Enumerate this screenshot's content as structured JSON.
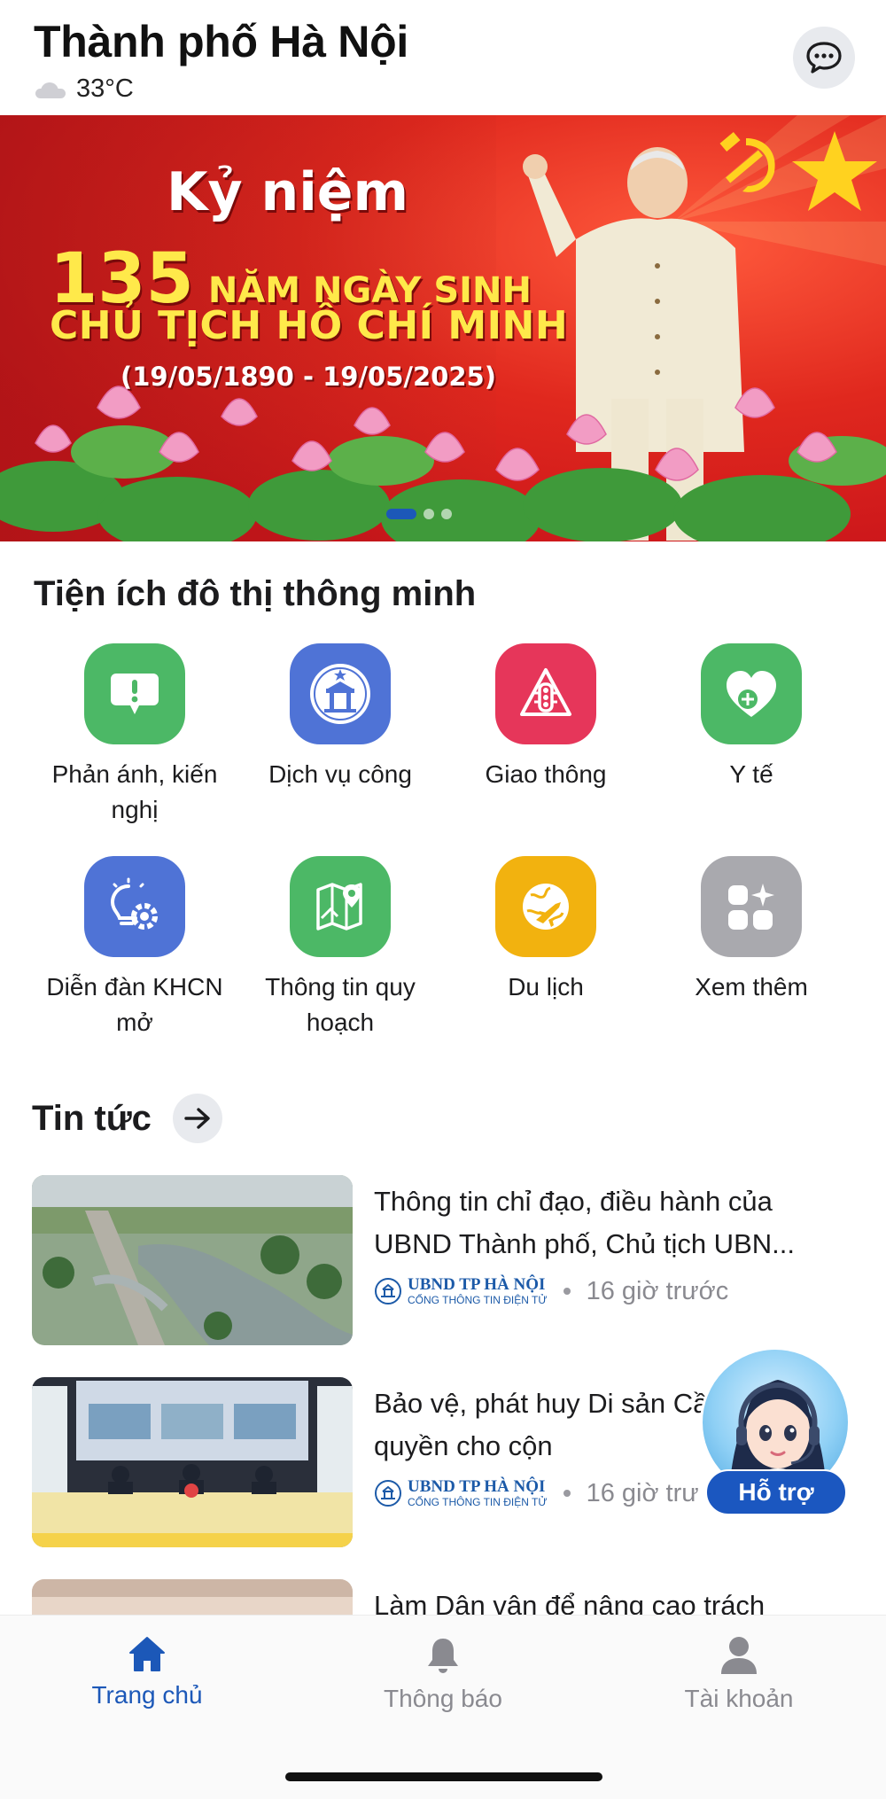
{
  "header": {
    "city": "Thành phố Hà Nội",
    "temperature": "33°C",
    "weather_icon": "cloud-icon",
    "chat_icon": "chat-bubble-icon"
  },
  "banner": {
    "title": "Kỷ niệm",
    "number": "135",
    "line1": "NĂM NGÀY SINH",
    "line2": "CHỦ TỊCH HỒ CHÍ MINH",
    "dates": "(19/05/1890 - 19/05/2025)",
    "active_slide": 1,
    "slide_count": 3
  },
  "utilities": {
    "title": "Tiện ích đô thị thông minh",
    "items": [
      {
        "label": "Phản ánh, kiến nghị",
        "icon": "feedback-icon",
        "color": "#4cb866"
      },
      {
        "label": "Dịch vụ công",
        "icon": "public-service-icon",
        "color": "#4f73d6"
      },
      {
        "label": "Giao thông",
        "icon": "traffic-light-icon",
        "color": "#e6365a"
      },
      {
        "label": "Y tế",
        "icon": "health-heart-icon",
        "color": "#4cb866"
      },
      {
        "label": "Diễn đàn KHCN mở",
        "icon": "innovation-bulb-icon",
        "color": "#4f73d6"
      },
      {
        "label": "Thông tin quy hoạch",
        "icon": "map-pin-icon",
        "color": "#4cb866"
      },
      {
        "label": "Du lịch",
        "icon": "travel-globe-icon",
        "color": "#f2b20f"
      },
      {
        "label": "Xem thêm",
        "icon": "more-apps-icon",
        "color": "#a9a9ae"
      }
    ]
  },
  "news": {
    "title": "Tin tức",
    "items": [
      {
        "headline": "Thông tin chỉ đạo, điều hành của UBND Thành phố, Chủ tịch UBN...",
        "source": "UBND TP HÀ NỘI",
        "source_sub": "CỔNG THÔNG TIN ĐIỆN TỬ",
        "time": "16 giờ trước"
      },
      {
        "headline": "Bảo vệ, phát huy Di sản Cần trao quyền cho cộn",
        "source": "UBND TP HÀ NỘI",
        "source_sub": "CỔNG THÔNG TIN ĐIỆN TỬ",
        "time": "16 giờ trư"
      },
      {
        "headline": "Làm Dân vận để nâng cao trách",
        "source": "",
        "source_sub": "",
        "time": ""
      }
    ]
  },
  "support": {
    "label": "Hỗ trợ"
  },
  "bottom_nav": {
    "items": [
      {
        "label": "Trang chủ",
        "icon": "home-icon",
        "active": true
      },
      {
        "label": "Thông báo",
        "icon": "bell-icon",
        "active": false
      },
      {
        "label": "Tài khoản",
        "icon": "user-icon",
        "active": false
      }
    ]
  }
}
